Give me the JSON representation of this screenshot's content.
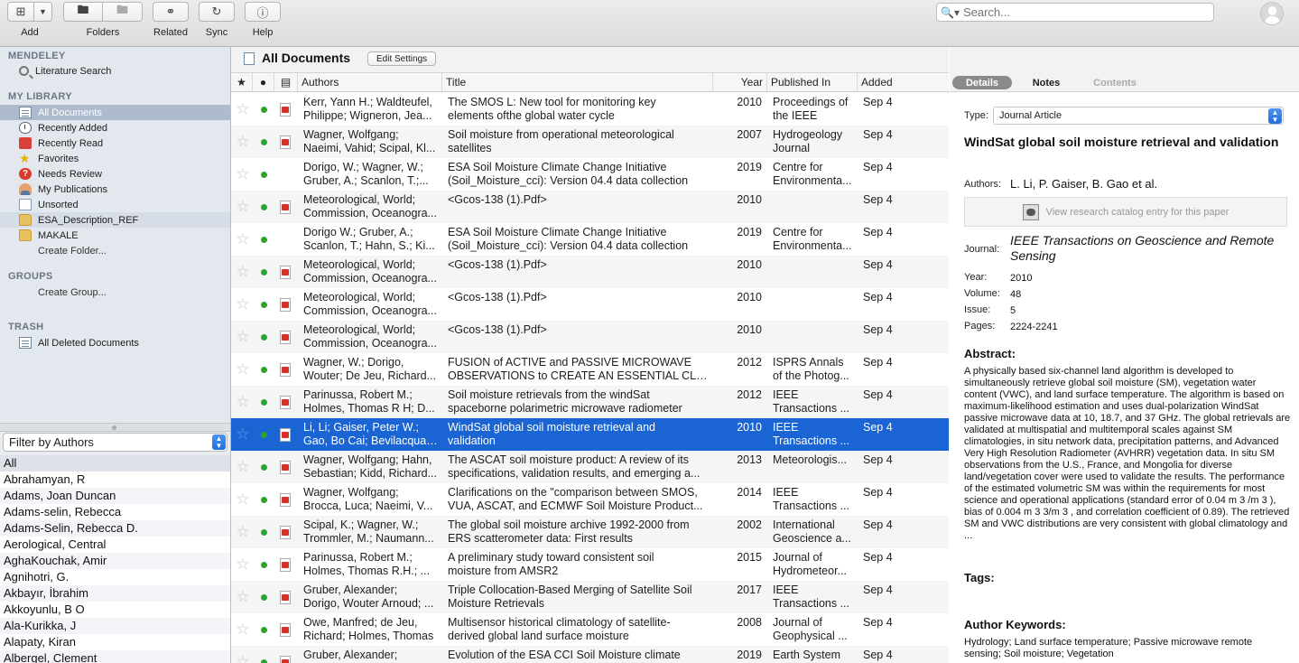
{
  "toolbar": {
    "add": "Add",
    "folders": "Folders",
    "related": "Related",
    "sync": "Sync",
    "help": "Help",
    "search_placeholder": "Search..."
  },
  "sidebar": {
    "mendeley_head": "MENDELEY",
    "literature_search": "Literature Search",
    "library_head": "MY LIBRARY",
    "library_items": [
      "All Documents",
      "Recently Added",
      "Recently Read",
      "Favorites",
      "Needs Review",
      "My Publications",
      "Unsorted",
      "ESA_Description_REF",
      "MAKALE"
    ],
    "create_folder": "Create Folder...",
    "groups_head": "GROUPS",
    "create_group": "Create Group...",
    "trash_head": "TRASH",
    "all_deleted": "All Deleted Documents"
  },
  "filter": {
    "label": "Filter by Authors",
    "authors": [
      "All",
      "Abrahamyan, R",
      "Adams, Joan Duncan",
      "Adams-selin, Rebecca",
      "Adams-Selin, Rebecca D.",
      "Aerological, Central",
      "AghaKouchak, Amir",
      "Agnihotri, G.",
      "Akbayır, İbrahim",
      "Akkoyunlu, B O",
      "Ala-Kurikka, J",
      "Alapaty, Kiran",
      "Albergel, Clement"
    ]
  },
  "doclist": {
    "title": "All Documents",
    "edit_settings": "Edit Settings",
    "columns": {
      "authors": "Authors",
      "title": "Title",
      "year": "Year",
      "published_in": "Published In",
      "added": "Added"
    },
    "rows": [
      {
        "a1": "Kerr, Yann H.; Waldteufel,",
        "a2": "Philippe; Wigneron, Jea...",
        "t1": "The SMOS L: New tool for monitoring key",
        "t2": "elements ofthe global water cycle",
        "year": "2010",
        "p1": "Proceedings of",
        "p2": "the IEEE",
        "added": "Sep 4",
        "pdf": true
      },
      {
        "a1": "Wagner, Wolfgang;",
        "a2": "Naeimi, Vahid; Scipal, Kl...",
        "t1": "Soil moisture from operational meteorological",
        "t2": "satellites",
        "year": "2007",
        "p1": "Hydrogeology",
        "p2": "Journal",
        "added": "Sep 4",
        "pdf": true
      },
      {
        "a1": "Dorigo, W.; Wagner, W.;",
        "a2": "Gruber, A.; Scanlon, T.;...",
        "t1": "ESA Soil Moisture Climate Change Initiative",
        "t2": "(Soil_Moisture_cci): Version 04.4 data collection",
        "year": "2019",
        "p1": "Centre for",
        "p2": "Environmenta...",
        "added": "Sep 4",
        "pdf": false
      },
      {
        "a1": "Meteorological, World;",
        "a2": "Commission, Oceanogra...",
        "t1": "<Gcos-138 (1).Pdf>",
        "t2": "",
        "year": "2010",
        "p1": "",
        "p2": "",
        "added": "Sep 4",
        "pdf": true
      },
      {
        "a1": "Dorigo  W.; Gruber, A.;",
        "a2": "Scanlon, T.; Hahn, S.; Ki...",
        "t1": "ESA Soil Moisture Climate Change Initiative",
        "t2": "(Soil_Moisture_cci): Version 04.4 data collection",
        "year": "2019",
        "p1": "Centre for",
        "p2": "Environmenta...",
        "added": "Sep 4",
        "pdf": false
      },
      {
        "a1": "Meteorological, World;",
        "a2": "Commission, Oceanogra...",
        "t1": "<Gcos-138 (1).Pdf>",
        "t2": "",
        "year": "2010",
        "p1": "",
        "p2": "",
        "added": "Sep 4",
        "pdf": true
      },
      {
        "a1": "Meteorological, World;",
        "a2": "Commission, Oceanogra...",
        "t1": "<Gcos-138 (1).Pdf>",
        "t2": "",
        "year": "2010",
        "p1": "",
        "p2": "",
        "added": "Sep 4",
        "pdf": true
      },
      {
        "a1": "Meteorological, World;",
        "a2": "Commission, Oceanogra...",
        "t1": "<Gcos-138 (1).Pdf>",
        "t2": "",
        "year": "2010",
        "p1": "",
        "p2": "",
        "added": "Sep 4",
        "pdf": true
      },
      {
        "a1": "Wagner, W.; Dorigo,",
        "a2": "Wouter; De Jeu, Richard...",
        "t1": "FUSION of ACTIVE and PASSIVE MICROWAVE",
        "t2": "OBSERVATIONS to CREATE AN ESSENTIAL CLIM...",
        "year": "2012",
        "p1": "ISPRS Annals",
        "p2": "of the Photog...",
        "added": "Sep 4",
        "pdf": true
      },
      {
        "a1": "Parinussa, Robert M.;",
        "a2": "Holmes, Thomas R H; D...",
        "t1": "Soil moisture retrievals from the windSat",
        "t2": "spaceborne polarimetric microwave radiometer",
        "year": "2012",
        "p1": "IEEE",
        "p2": "Transactions ...",
        "added": "Sep 4",
        "pdf": true
      },
      {
        "a1": "Li, Li; Gaiser, Peter W.;",
        "a2": "Gao, Bo Cai; Bevilacqua,...",
        "t1": "WindSat global soil moisture retrieval and",
        "t2": "validation",
        "year": "2010",
        "p1": "IEEE",
        "p2": "Transactions ...",
        "added": "Sep 4",
        "pdf": true,
        "selected": true
      },
      {
        "a1": "Wagner, Wolfgang; Hahn,",
        "a2": "Sebastian; Kidd, Richard...",
        "t1": "The ASCAT soil moisture product: A review of its",
        "t2": "specifications, validation results, and emerging a...",
        "year": "2013",
        "p1": "Meteorologis...",
        "p2": "",
        "added": "Sep 4",
        "pdf": true
      },
      {
        "a1": "Wagner, Wolfgang;",
        "a2": "Brocca, Luca; Naeimi, V...",
        "t1": "Clarifications on the \"comparison between SMOS,",
        "t2": "VUA, ASCAT, and ECMWF Soil Moisture Product...",
        "year": "2014",
        "p1": "IEEE",
        "p2": "Transactions ...",
        "added": "Sep 4",
        "pdf": true
      },
      {
        "a1": "Scipal, K.; Wagner, W.;",
        "a2": "Trommler, M.; Naumann...",
        "t1": "The global soil moisture archive 1992-2000 from",
        "t2": "ERS scatterometer data: First results",
        "year": "2002",
        "p1": "International",
        "p2": "Geoscience a...",
        "added": "Sep 4",
        "pdf": true
      },
      {
        "a1": "Parinussa, Robert M.;",
        "a2": "Holmes, Thomas R.H.; ...",
        "t1": "A preliminary study toward consistent soil",
        "t2": "moisture from AMSR2",
        "year": "2015",
        "p1": "Journal of",
        "p2": "Hydrometeor...",
        "added": "Sep 4",
        "pdf": true
      },
      {
        "a1": "Gruber, Alexander;",
        "a2": "Dorigo, Wouter Arnoud; ...",
        "t1": "Triple Collocation-Based Merging of Satellite Soil",
        "t2": "Moisture Retrievals",
        "year": "2017",
        "p1": "IEEE",
        "p2": "Transactions ...",
        "added": "Sep 4",
        "pdf": true
      },
      {
        "a1": "Owe, Manfred; de Jeu,",
        "a2": "Richard; Holmes, Thomas",
        "t1": "Multisensor historical climatology of satellite-",
        "t2": "derived global land surface moisture",
        "year": "2008",
        "p1": "Journal of",
        "p2": "Geophysical ...",
        "added": "Sep 4",
        "pdf": true
      },
      {
        "a1": "Gruber, Alexander;",
        "a2": "",
        "t1": "Evolution of the ESA CCI Soil Moisture climate",
        "t2": "",
        "year": "2019",
        "p1": "Earth System",
        "p2": "",
        "added": "Sep 4",
        "pdf": true
      }
    ]
  },
  "details": {
    "tab_details": "Details",
    "tab_notes": "Notes",
    "tab_contents": "Contents",
    "type_label": "Type:",
    "type_value": "Journal Article",
    "title": "WindSat global soil moisture retrieval and validation",
    "authors_label": "Authors:",
    "authors_value": "L. Li, P. Gaiser, B. Gao et al.",
    "catalog": "View research catalog entry for this paper",
    "journal_label": "Journal:",
    "journal_value": "IEEE Transactions on Geoscience and Remote Sensing",
    "year_label": "Year:",
    "year_value": "2010",
    "volume_label": "Volume:",
    "volume_value": "48",
    "issue_label": "Issue:",
    "issue_value": "5",
    "pages_label": "Pages:",
    "pages_value": "2224-2241",
    "abstract_head": "Abstract:",
    "abstract": "A physically based six-channel land algorithm is developed to simultaneously retrieve global soil moisture (SM), vegetation water content (VWC), and land surface temperature. The algorithm is based on maximum-likelihood estimation and uses dual-polarization WindSat passive microwave data at 10, 18.7, and 37 GHz. The global retrievals are validated at multispatial and multitemporal scales against SM climatologies, in situ network data, precipitation patterns, and Advanced Very High Resolution Radiometer (AVHRR) vegetation data. In situ SM observations from the U.S., France, and Mongolia for diverse land/vegetation cover were used to validate the results. The performance of the estimated volumetric SM was within the requirements for most science and operational applications (standard error of 0.04 m 3 /m 3 ), bias of 0.004 m 3 3/m 3 , and correlation coefficient of 0.89). The retrieved SM and VWC distributions are very consistent with global climatology and ...",
    "tags_head": "Tags:",
    "keywords_head": "Author Keywords:",
    "keywords": "Hydrology; Land surface temperature; Passive microwave remote sensing; Soil moisture; Vegetation"
  }
}
